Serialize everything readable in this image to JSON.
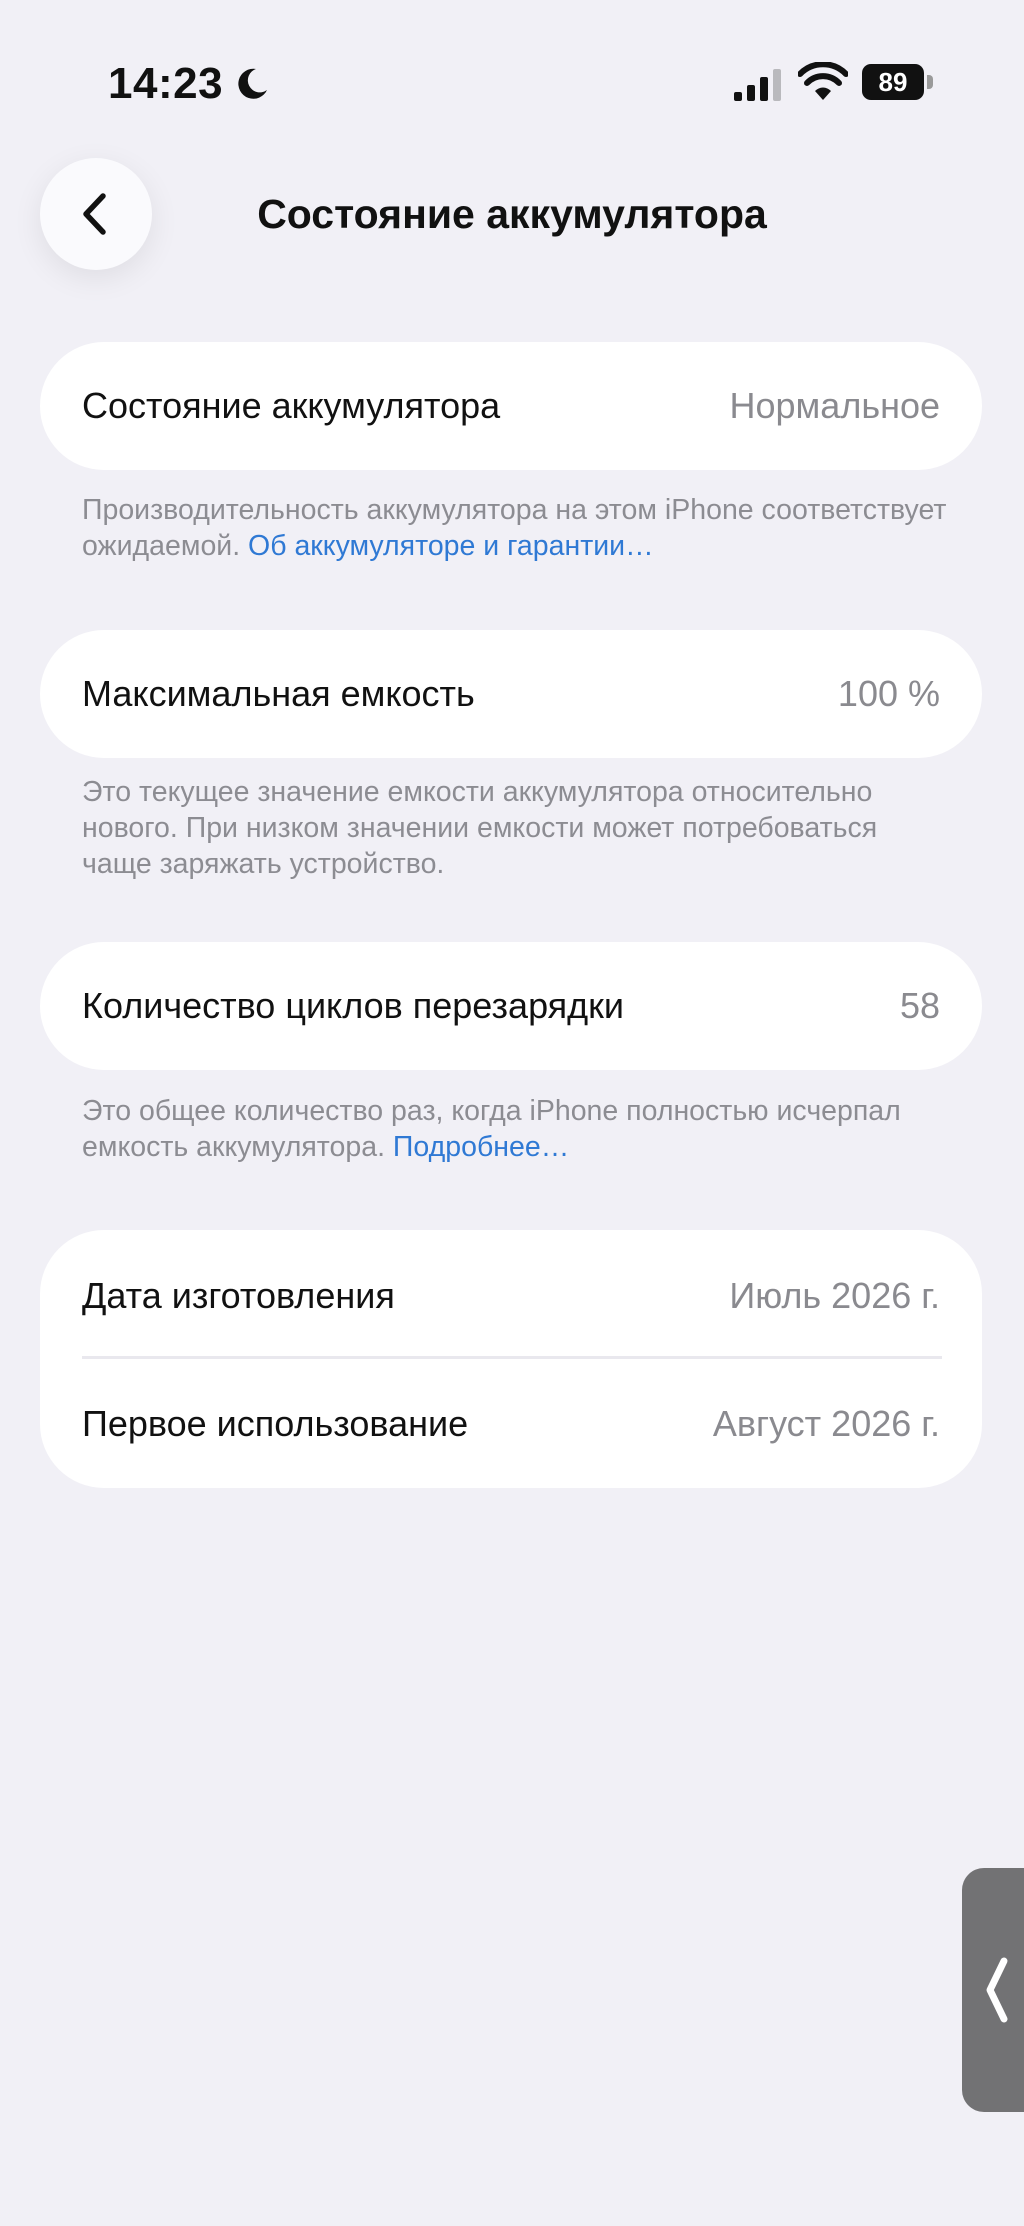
{
  "status_bar": {
    "time": "14:23",
    "battery_level": "89",
    "icons": [
      "moon-icon",
      "cellular-signal-icon",
      "wifi-icon",
      "battery-icon"
    ]
  },
  "nav": {
    "title": "Состояние аккумулятора",
    "back_icon": "chevron-left-icon"
  },
  "sections": {
    "health": {
      "label": "Состояние аккумулятора",
      "value": "Нормальное",
      "footnote_text": "Производительность аккумулятора на этом iPhone соот­ветствует ожидаемой. ",
      "footnote_link": "Об аккумуляторе и гарантии…"
    },
    "capacity": {
      "label": "Максимальная емкость",
      "value": "100 %",
      "footnote_text": "Это текущее значение емкости аккумулятора относительно нового. При низком значении емкости может потребоваться чаще заряжать устройство."
    },
    "cycles": {
      "label": "Количество циклов перезарядки",
      "value": "58",
      "footnote_text": "Это общее количество раз, когда iPhone полностью исчерпал емкость аккумулятора. ",
      "footnote_link": "Подробнее…"
    },
    "dates": {
      "manufacture_label": "Дата изготовления",
      "manufacture_value": "Июль 2026 г.",
      "first_use_label": "Первое использование",
      "first_use_value": "Август 2026 г."
    }
  },
  "side_handle": {
    "icon": "chevron-left-icon"
  },
  "colors": {
    "background": "#f1f0f6",
    "card": "#ffffff",
    "link": "#2f79d4",
    "secondary_text": "#8a8a8f"
  }
}
